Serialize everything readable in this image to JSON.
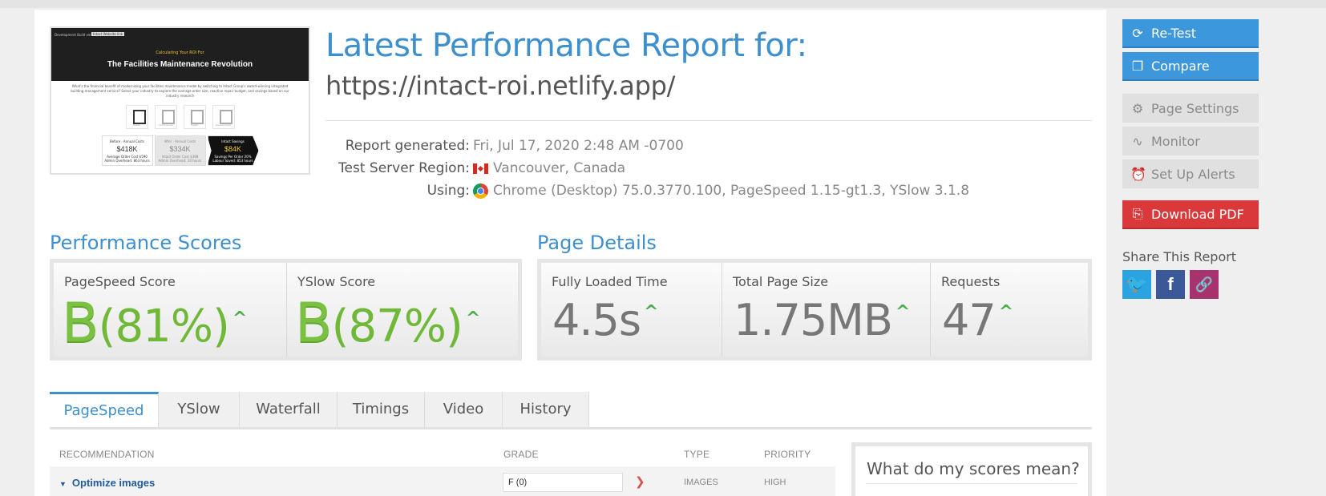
{
  "report": {
    "headline": "Latest Performance Report for:",
    "url": "https://intact-roi.netlify.app/"
  },
  "thumbnail": {
    "top_tag": "Development Build ver.1001",
    "top_tag2": "Intact Website link",
    "small_heading": "Calculating Your ROI For",
    "title": "The Facilities Maintenance Revolution",
    "body": "What's the financial benefit of modernizing your facilities maintenance model by switching to Intact Group's award-winning integrated building management service? Select your industry to explore the average order size, reactive repair budget, and savings based on our industry research",
    "icons": [
      "Retail",
      "Commercial",
      "Health",
      "Government"
    ],
    "boxes": [
      {
        "label": "Before · Annual Costs",
        "value": "$418K",
        "line1": "Average Order Cost $590",
        "line2": "Admin Overhead: 863 hours"
      },
      {
        "label": "After · Annual Costs",
        "value": "$334K",
        "line1": "Intact Order Cost $388",
        "line2": "Admin Overhead: 10 hours"
      },
      {
        "label": "Intact Savings",
        "value": "$84K",
        "line1": "Savings Per Order 20%",
        "line2": "Labour Saved: 853 hours"
      }
    ]
  },
  "meta": {
    "generated_label": "Report generated:",
    "generated_value": "Fri, Jul 17, 2020 2:48 AM -0700",
    "region_label": "Test Server Region:",
    "region_value": "Vancouver, Canada",
    "using_label": "Using:",
    "using_value": "Chrome (Desktop) 75.0.3770.100, PageSpeed 1.15-gt1.3, YSlow 3.1.8"
  },
  "performance": {
    "title": "Performance Scores",
    "pagespeed": {
      "label": "PageSpeed Score",
      "grade": "B",
      "percent": "(81%)"
    },
    "yslow": {
      "label": "YSlow Score",
      "grade": "B",
      "percent": "(87%)"
    }
  },
  "details": {
    "title": "Page Details",
    "load_time": {
      "label": "Fully Loaded Time",
      "value": "4.5s"
    },
    "page_size": {
      "label": "Total Page Size",
      "value": "1.75MB"
    },
    "requests": {
      "label": "Requests",
      "value": "47"
    }
  },
  "tabs": [
    "PageSpeed",
    "YSlow",
    "Waterfall",
    "Timings",
    "Video",
    "History"
  ],
  "table": {
    "headers": {
      "recommendation": "RECOMMENDATION",
      "grade": "GRADE",
      "type": "TYPE",
      "priority": "PRIORITY"
    },
    "rows": [
      {
        "name": "Optimize images",
        "grade": "F (0)",
        "type": "IMAGES",
        "priority": "HIGH"
      }
    ]
  },
  "scores_help": {
    "title": "What do my scores mean?"
  },
  "sidebar": {
    "retest": "Re-Test",
    "compare": "Compare",
    "page_settings": "Page Settings",
    "monitor": "Monitor",
    "alerts": "Set Up Alerts",
    "download": "Download PDF",
    "share_title": "Share This Report"
  },
  "colors": {
    "accent": "#3d8fce",
    "grade_green": "#7ac142",
    "alert_red": "#d9393a"
  }
}
